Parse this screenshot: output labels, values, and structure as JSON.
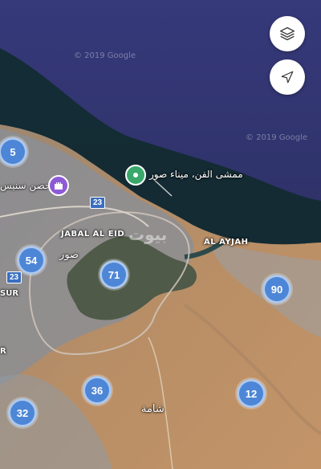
{
  "map": {
    "water_watermarks": [
      "© 2019 Google",
      "© 2019 Google"
    ],
    "controls": {
      "layers_icon": "layers-icon",
      "locate_icon": "navigation-arrow-icon"
    },
    "place_labels": {
      "hisn_sunaysilah": "حصن سنيس",
      "jabal_al_eid": "JABAL AL EID",
      "sur_ar": "صور",
      "al_ayjah": "AL AYJAH",
      "shamah": "شامة",
      "sur_en": "SUR",
      "edge_r": "R"
    },
    "road_shields": [
      "23",
      "23"
    ],
    "poi": {
      "harbor_label": "ممشى الفن، ميناء صور",
      "harbor_color": "#3aa86b",
      "fort_color": "#8e5ad6",
      "fort_icon": "castle-icon",
      "harbor_icon": "pin-dot-icon"
    },
    "watermark": "بيوت",
    "clusters": [
      "5",
      "54",
      "71",
      "90",
      "36",
      "12",
      "32"
    ],
    "cluster_color": "#4d86d6"
  }
}
